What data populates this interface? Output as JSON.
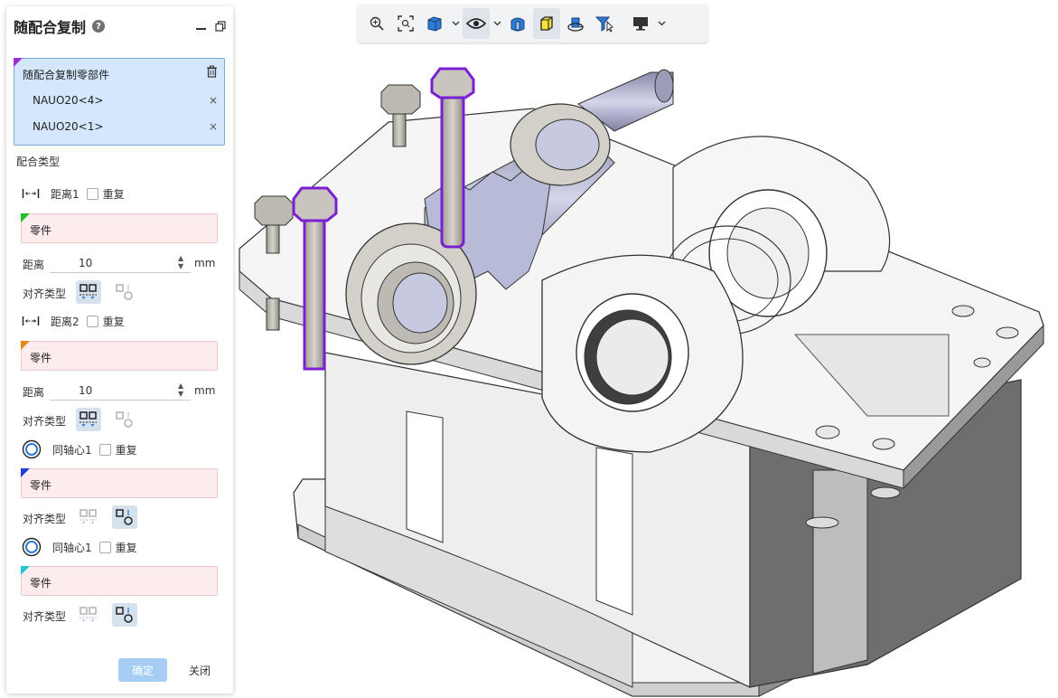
{
  "panel": {
    "title": "随配合复制",
    "selection_box": {
      "title": "随配合复制零部件",
      "items": [
        "NAUO20<4>",
        "NAUO20<1>"
      ],
      "remove_glyph": "×"
    },
    "mate_type_label": "配合类型",
    "mates": [
      {
        "name": "距离1",
        "repeat_label": "重复",
        "icon": "distance-icon",
        "part_label": "零件",
        "corner_color": "#22c02a",
        "has_distance": true,
        "distance_label": "距离",
        "distance_value": "10",
        "unit": "mm",
        "align_label": "对齐类型",
        "align_selected": 0
      },
      {
        "name": "距离2",
        "repeat_label": "重复",
        "icon": "distance-icon",
        "part_label": "零件",
        "corner_color": "#e08a12",
        "has_distance": true,
        "distance_label": "距离",
        "distance_value": "10",
        "unit": "mm",
        "align_label": "对齐类型",
        "align_selected": 0
      },
      {
        "name": "同轴心1",
        "repeat_label": "重复",
        "icon": "concentric-icon",
        "part_label": "零件",
        "corner_color": "#1f3fd8",
        "has_distance": false,
        "align_label": "对齐类型",
        "align_selected": 1
      },
      {
        "name": "同轴心1",
        "repeat_label": "重复",
        "icon": "concentric-icon",
        "part_label": "零件",
        "corner_color": "#20c9d6",
        "has_distance": false,
        "align_label": "对齐类型",
        "align_selected": 1
      }
    ],
    "ok_label": "确定",
    "close_label": "关闭",
    "selection_corner_color": "#9b2fd8"
  },
  "toolbar": {
    "items": [
      "zoom-icon",
      "zoom-fit-icon",
      "view-cube-icon",
      "visibility-eye-icon",
      "section-view-icon",
      "shaded-cube-icon",
      "rotate-icon",
      "filter-select-icon",
      "display-monitor-icon"
    ]
  },
  "colors": {
    "highlight": "#7a1fd4",
    "part_fill": "#f0f0f0",
    "gear_fill": "#b9bcd8"
  }
}
